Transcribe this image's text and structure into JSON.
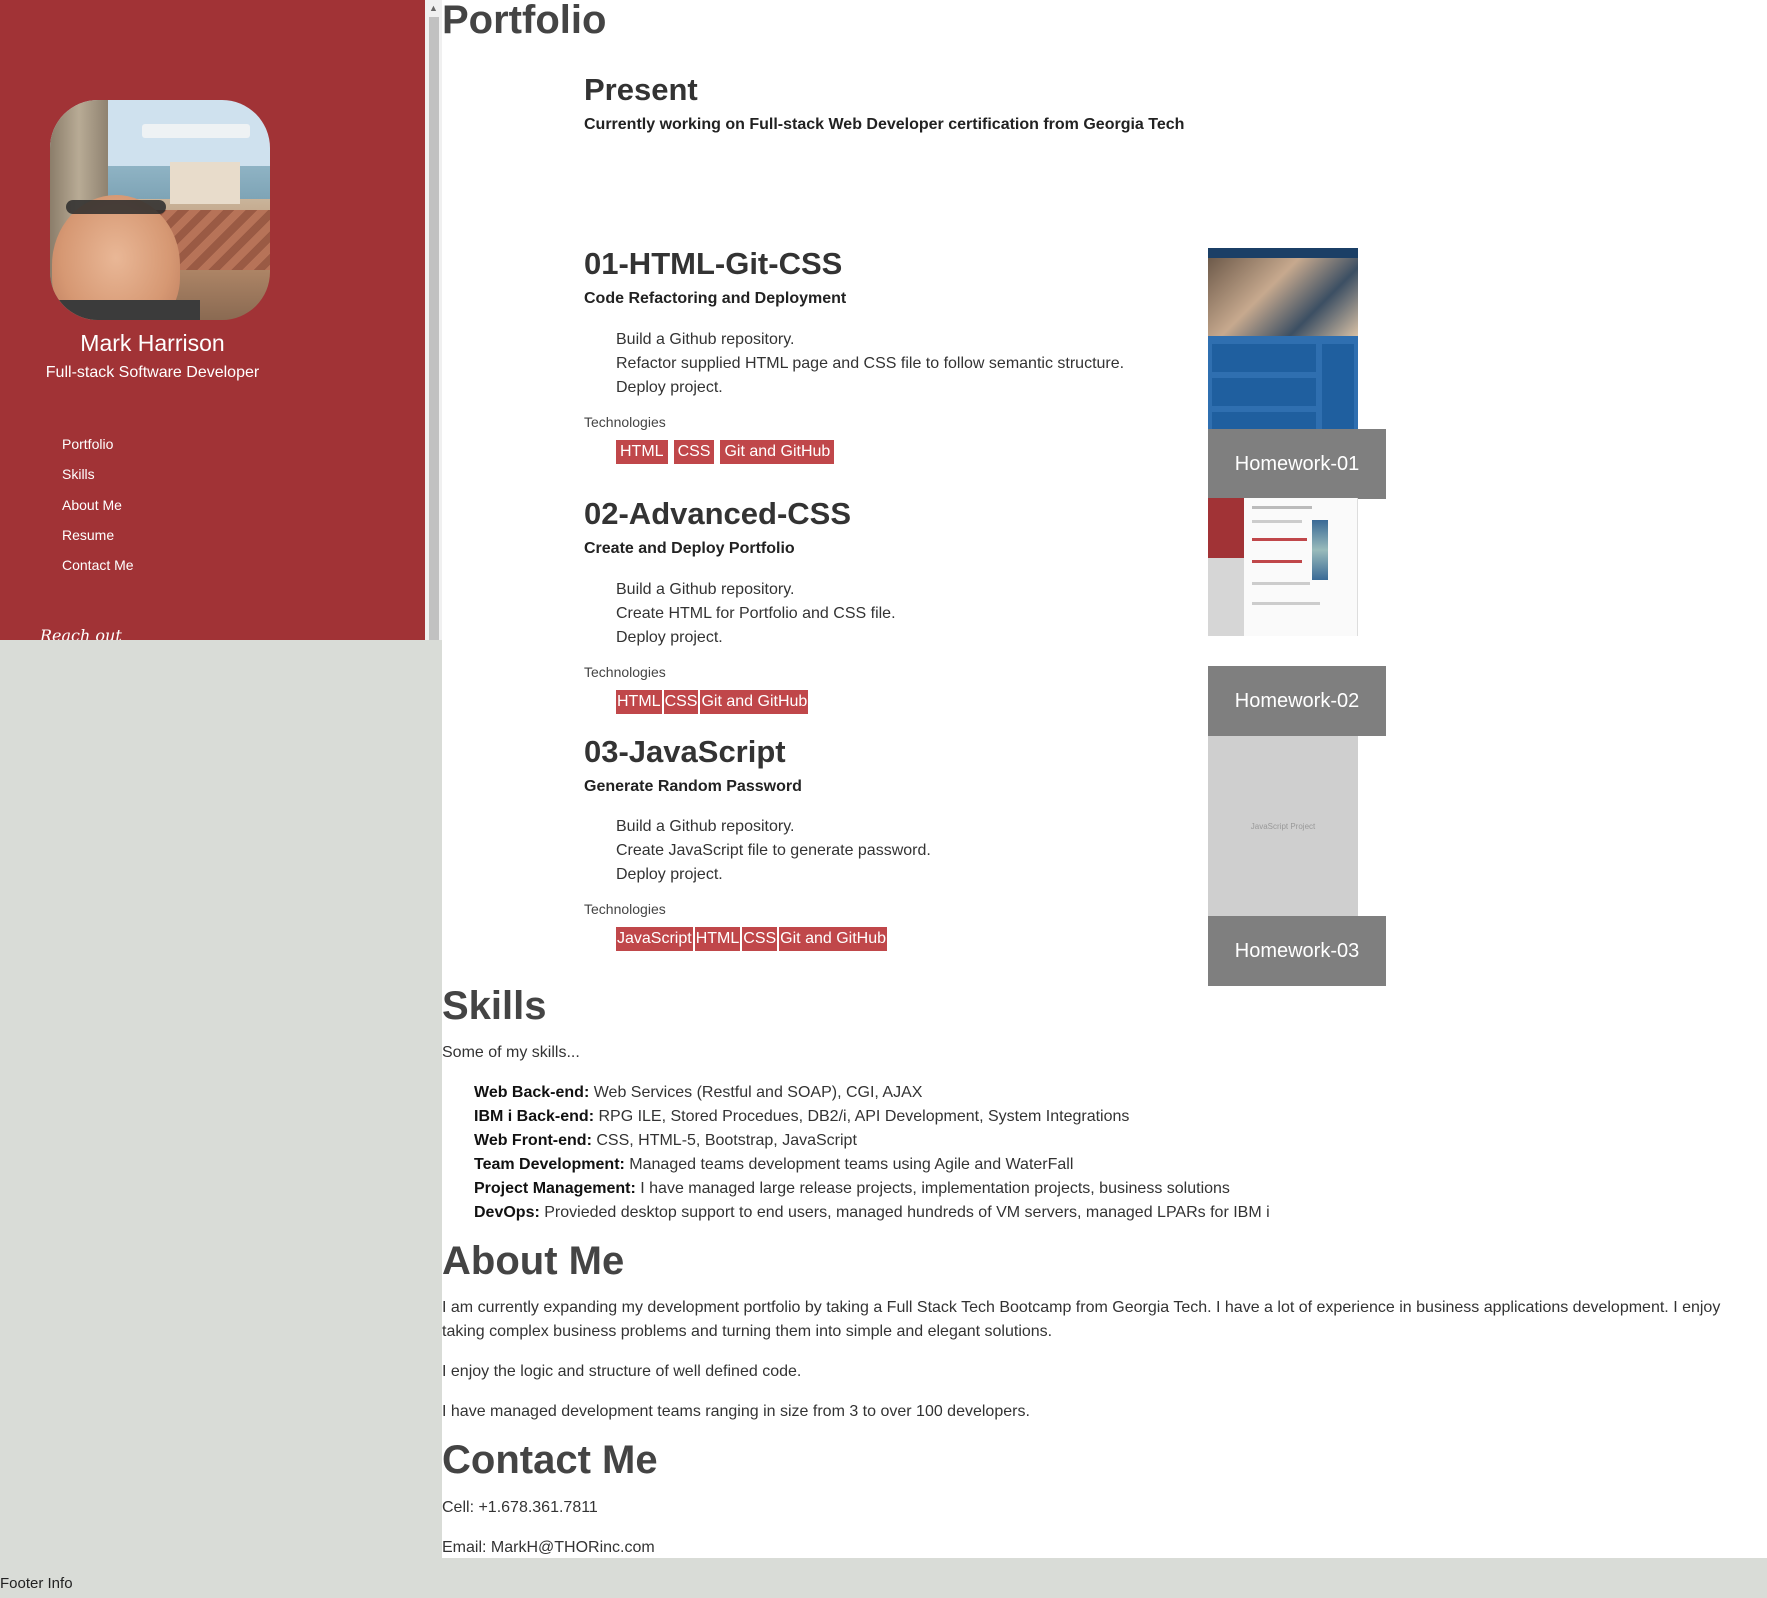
{
  "sidebar": {
    "name": "Mark Harrison",
    "title": "Full-stack Software Developer",
    "nav": [
      "Portfolio",
      "Skills",
      "About Me",
      "Resume",
      "Contact Me"
    ],
    "reach_out": "Reach out"
  },
  "portfolio": {
    "heading": "Portfolio",
    "present": {
      "title": "Present",
      "subtitle": "Currently working on Full-stack Web Developer certification from Georgia Tech"
    },
    "technologies_label": "Technologies",
    "projects": [
      {
        "title": "01-HTML-Git-CSS",
        "subtitle": "Code Refactoring and Deployment",
        "bullets": [
          "Build a Github repository.",
          "Refactor supplied HTML page and CSS file to follow semantic structure.",
          "Deploy project."
        ],
        "tech": [
          "HTML",
          "CSS",
          "Git and GitHub"
        ],
        "homework": "Homework-01"
      },
      {
        "title": "02-Advanced-CSS",
        "subtitle": "Create and Deploy Portfolio",
        "bullets": [
          "Build a Github repository.",
          "Create HTML for Portfolio and CSS file.",
          "Deploy project."
        ],
        "tech": [
          "HTML",
          "CSS",
          "Git and GitHub"
        ],
        "homework": "Homework-02"
      },
      {
        "title": "03-JavaScript",
        "subtitle": "Generate Random Password",
        "bullets": [
          "Build a Github repository.",
          "Create JavaScript file to generate password.",
          "Deploy project."
        ],
        "tech": [
          "JavaScript",
          "HTML",
          "CSS",
          "Git and GitHub"
        ],
        "homework": "Homework-03",
        "placeholder": "JavaScript Project"
      }
    ]
  },
  "skills": {
    "heading": "Skills",
    "intro": "Some of my skills...",
    "items": [
      {
        "label": "Web Back-end:",
        "text": " Web Services (Restful and SOAP), CGI, AJAX"
      },
      {
        "label": "IBM i Back-end:",
        "text": " RPG ILE, Stored Procedues, DB2/i, API Development, System Integrations"
      },
      {
        "label": "Web Front-end:",
        "text": " CSS, HTML-5, Bootstrap, JavaScript"
      },
      {
        "label": "Team Development:",
        "text": " Managed teams development teams using Agile and WaterFall"
      },
      {
        "label": "Project Management:",
        "text": " I have managed large release projects, implementation projects, business solutions"
      },
      {
        "label": "DevOps:",
        "text": " Provieded desktop support to end users, managed hundreds of VM servers, managed LPARs for IBM i"
      }
    ]
  },
  "about": {
    "heading": "About Me",
    "paragraphs": [
      "I am currently expanding my development portfolio by taking a Full Stack Tech Bootcamp from Georgia Tech. I have a lot of experience in business applications development. I enjoy taking complex business problems and turning them into simple and elegant solutions.",
      "I enjoy the logic and structure of well defined code.",
      "I have managed development teams ranging in size from 3 to over 100 developers."
    ]
  },
  "contact": {
    "heading": "Contact Me",
    "cell": "Cell: +1.678.361.7811",
    "email": "Email: MarkH@THORinc.com"
  },
  "footer": "Footer Info",
  "colors": {
    "sidebar": "#a13336",
    "badge": "#c0474a",
    "homework": "#7f7f7f",
    "page": "#d9dcd7"
  }
}
